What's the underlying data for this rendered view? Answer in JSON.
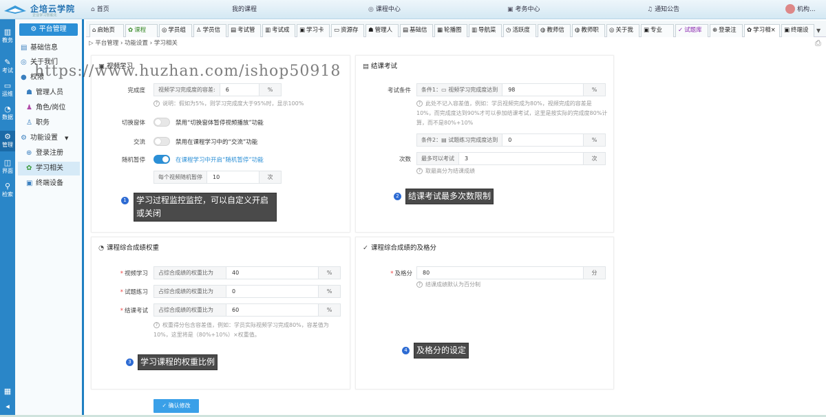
{
  "app": {
    "logo_title": "企培云学院",
    "logo_sub": "企业学习智能化"
  },
  "topnav": [
    {
      "label": "首页",
      "icon": "home-icon"
    },
    {
      "label": "我的课程",
      "icon": ""
    },
    {
      "label": "课程中心",
      "icon": "globe-icon"
    },
    {
      "label": "考务中心",
      "icon": "calendar-icon"
    },
    {
      "label": "通知公告",
      "icon": "bell-icon"
    },
    {
      "label": "机构...",
      "icon": "user-avatar"
    }
  ],
  "leftbar": [
    {
      "label": "教务",
      "icon": "bar-chart-icon"
    },
    {
      "label": "考试",
      "icon": "edit-icon"
    },
    {
      "label": "运维",
      "icon": "monitor-icon"
    },
    {
      "label": "数据",
      "icon": "pie-icon"
    },
    {
      "label": "管理",
      "icon": "gear-icon"
    },
    {
      "label": "界面",
      "icon": "layout-icon"
    },
    {
      "label": "检索",
      "icon": "search-icon"
    }
  ],
  "menu": {
    "head": "平台管理",
    "items": [
      "基础信息",
      "关于我们",
      "权限",
      "管理人员",
      "角色/岗位",
      "职务",
      "功能设置",
      "登录注册",
      "学习相关",
      "终端设备"
    ]
  },
  "tabs": [
    "启始页",
    "课程",
    "学员组",
    "学员信",
    "考试管",
    "考试成",
    "学习卡",
    "资源存",
    "管理人",
    "基础信",
    "轮播图",
    "导航菜",
    "活跃度",
    "教师信",
    "教师职",
    "关于我",
    "专业",
    "试题库",
    "登录注",
    "学习相×",
    "终端设"
  ],
  "breadcrumb": "平台管理 › 功能设置 › 学习相关",
  "video": {
    "title": "视频学习",
    "completion_label": "完成度",
    "completion_prefix": "视频学习完成度的容差:",
    "completion_value": "6",
    "completion_unit": "%",
    "completion_hint": "说明：假如为5%，则学习完成度大于95%时，显示100%",
    "switch_window_label": "切换窗体",
    "switch_window_text": "禁用“切换窗体暂停视频播放”功能",
    "switch_window_on": false,
    "exchange_label": "交流",
    "exchange_text": "禁用在课程学习中的“交流”功能",
    "exchange_on": false,
    "random_label": "随机暂停",
    "random_text": "在课程学习中开启“随机暂停”功能",
    "random_on": true,
    "random_prefix": "每个视频随机暂停",
    "random_value": "10",
    "random_unit": "次"
  },
  "finish": {
    "title": "结课考试",
    "cond_label": "考试条件",
    "cond1_prefix": "条件1：▭ 视频学习完成度达到",
    "cond1_value": "98",
    "cond1_unit": "%",
    "cond_hint": "此处不记入容差值，例如：学员视频完成为80%，视频完成的容差是10%，而完成度达到90%才可以参加结课考试，这里是按实际的完成度80%计算，而不是80%+10%",
    "cond2_prefix": "条件2：▤ 试题练习完成度达到",
    "cond2_value": "0",
    "cond2_unit": "%",
    "times_label": "次数",
    "times_prefix": "最多可以考试",
    "times_value": "3",
    "times_unit": "次",
    "times_hint": "取最高分为结课成绩"
  },
  "weight": {
    "title": "课程综合成绩权重",
    "rows": [
      {
        "label": "视频学习",
        "prefix": "占综合成绩的权重比为",
        "value": "40",
        "unit": "%"
      },
      {
        "label": "试题练习",
        "prefix": "占综合成绩的权重比为",
        "value": "0",
        "unit": "%"
      },
      {
        "label": "结课考试",
        "prefix": "占综合成绩的权重比为",
        "value": "60",
        "unit": "%"
      }
    ],
    "hint": "权重得分包含容差值，例如：学员实际视频学习完成80%，容差值为10%，这里将是（80%+10%）×权重值。"
  },
  "pass": {
    "title": "课程综合成绩的及格分",
    "label": "及格分",
    "value": "80",
    "unit": "分",
    "hint": "结课成绩默认为百分制"
  },
  "callouts": [
    {
      "num": "1",
      "text": "学习过程监控监控，可以自定义开启或关闭"
    },
    {
      "num": "2",
      "text": "结课考试最多次数限制"
    },
    {
      "num": "3",
      "text": "学习课程的权重比例"
    },
    {
      "num": "4",
      "text": "及格分的设定"
    }
  ],
  "save_button": "✓ 确认修改",
  "watermark": "https://www.huzhan.com/ishop50918"
}
